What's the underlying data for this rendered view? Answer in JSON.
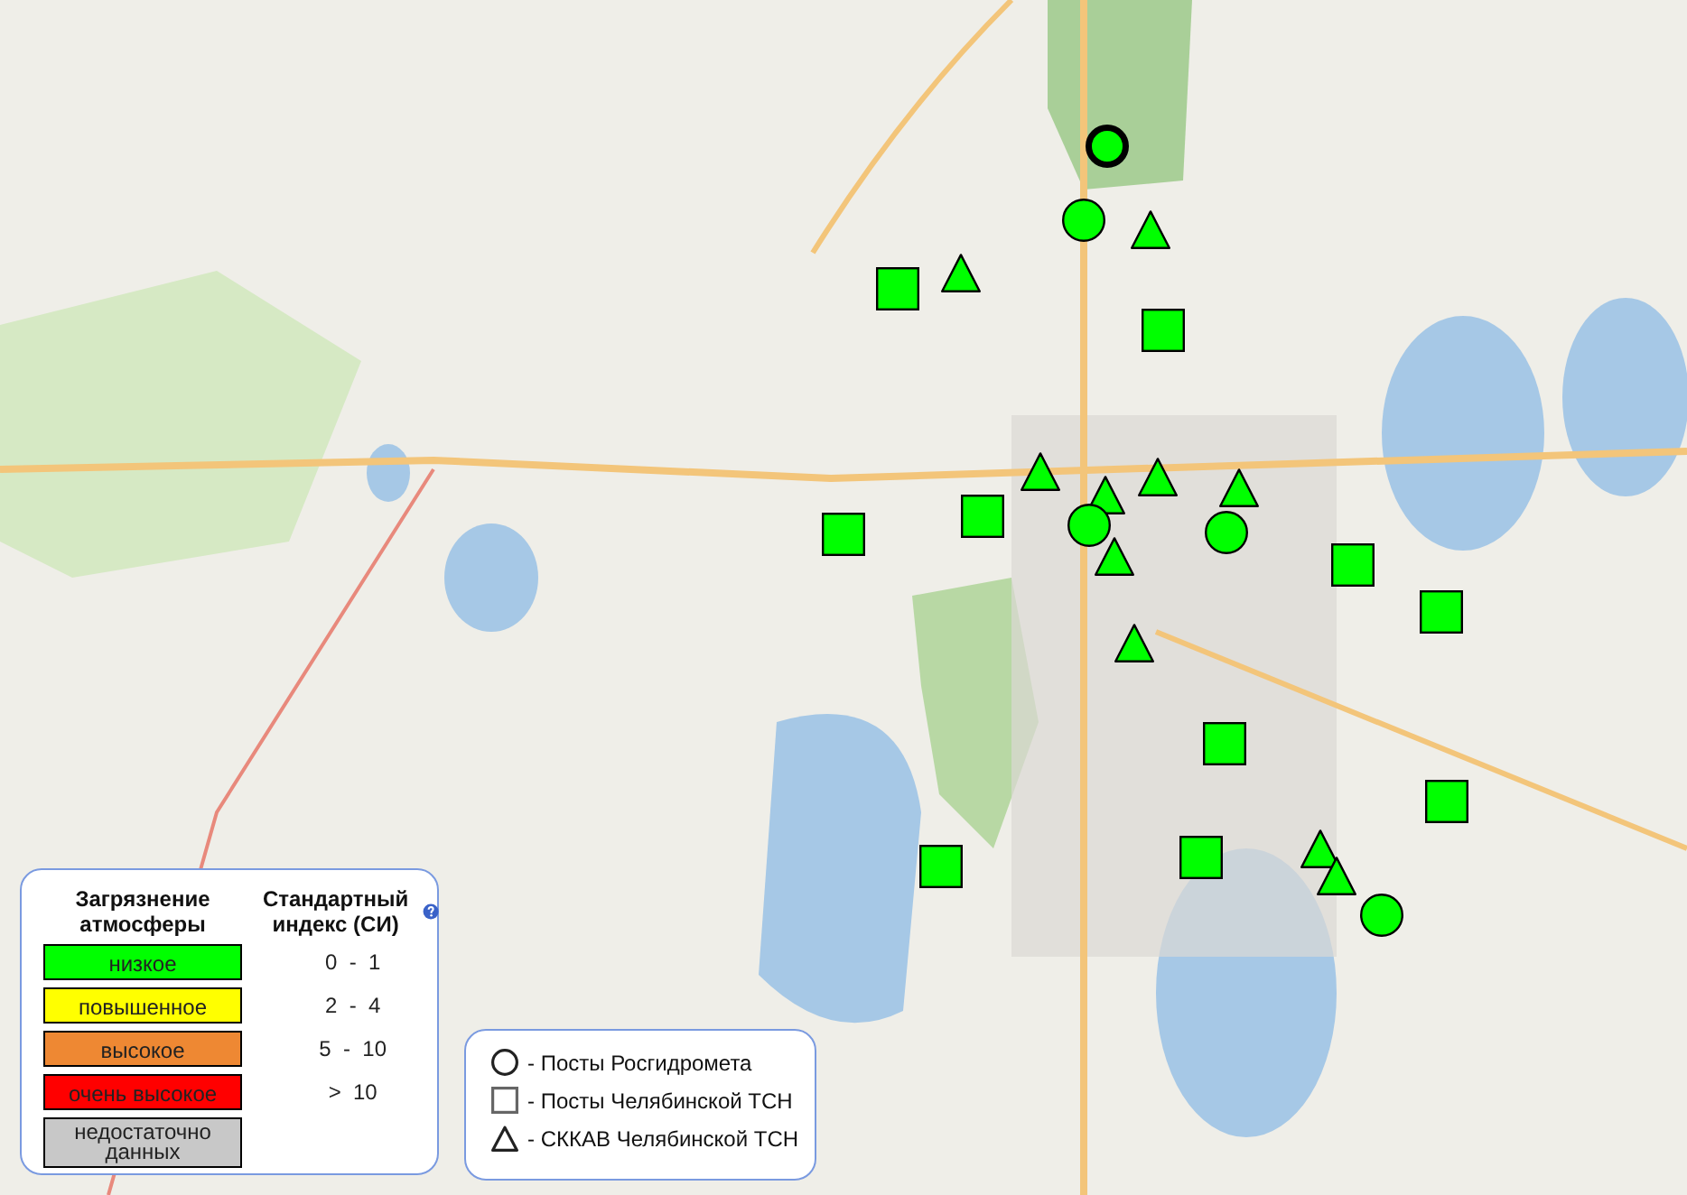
{
  "markers": [
    {
      "kind": "circle",
      "color": "#00ff00",
      "selected": true
    },
    {
      "kind": "circle",
      "color": "#00ff00",
      "selected": false
    },
    {
      "kind": "triangle",
      "color": "#00ff00",
      "selected": false
    },
    {
      "kind": "square",
      "color": "#00ff00",
      "selected": false
    },
    {
      "kind": "triangle",
      "color": "#00ff00",
      "selected": false
    },
    {
      "kind": "square",
      "color": "#00ff00",
      "selected": false
    },
    {
      "kind": "triangle",
      "color": "#00ff00",
      "selected": false
    },
    {
      "kind": "triangle",
      "color": "#00ff00",
      "selected": false
    },
    {
      "kind": "triangle",
      "color": "#00ff00",
      "selected": false
    },
    {
      "kind": "triangle",
      "color": "#00ff00",
      "selected": false
    },
    {
      "kind": "square",
      "color": "#00ff00",
      "selected": false
    },
    {
      "kind": "square",
      "color": "#00ff00",
      "selected": false
    },
    {
      "kind": "circle",
      "color": "#00ff00",
      "selected": false
    },
    {
      "kind": "circle",
      "color": "#00ff00",
      "selected": false
    },
    {
      "kind": "triangle",
      "color": "#00ff00",
      "selected": false
    },
    {
      "kind": "square",
      "color": "#00ff00",
      "selected": false
    },
    {
      "kind": "square",
      "color": "#00ff00",
      "selected": false
    },
    {
      "kind": "triangle",
      "color": "#00ff00",
      "selected": false
    },
    {
      "kind": "square",
      "color": "#00ff00",
      "selected": false
    },
    {
      "kind": "square",
      "color": "#00ff00",
      "selected": false
    },
    {
      "kind": "square",
      "color": "#00ff00",
      "selected": false
    },
    {
      "kind": "triangle",
      "color": "#00ff00",
      "selected": false
    },
    {
      "kind": "triangle",
      "color": "#00ff00",
      "selected": false
    },
    {
      "kind": "circle",
      "color": "#00ff00",
      "selected": false
    },
    {
      "kind": "square",
      "color": "#00ff00",
      "selected": false
    }
  ],
  "pollution_legend": {
    "heading_level": "Загрязнение атмосферы",
    "heading_index": "Стандартный индекс (СИ)",
    "levels": [
      {
        "label": "низкое",
        "color": "#00ff00",
        "range": "0  -  1"
      },
      {
        "label": "повышенное",
        "color": "#ffff00",
        "range": "2  -  4"
      },
      {
        "label": "высокое",
        "color": "#ee8833",
        "range": "5  -  10"
      },
      {
        "label": "очень высокое",
        "color": "#ff0000",
        "range": ">  10"
      },
      {
        "label": "недостаточно данных",
        "color": "#c8c8c8"
      }
    ]
  },
  "station_legend": [
    {
      "kind": "circle",
      "label": "- Посты Росгидромета"
    },
    {
      "kind": "square",
      "label": "- Посты Челябинской ТСН"
    },
    {
      "kind": "triangle",
      "label": "- СККАВ Челябинской ТСН"
    }
  ]
}
